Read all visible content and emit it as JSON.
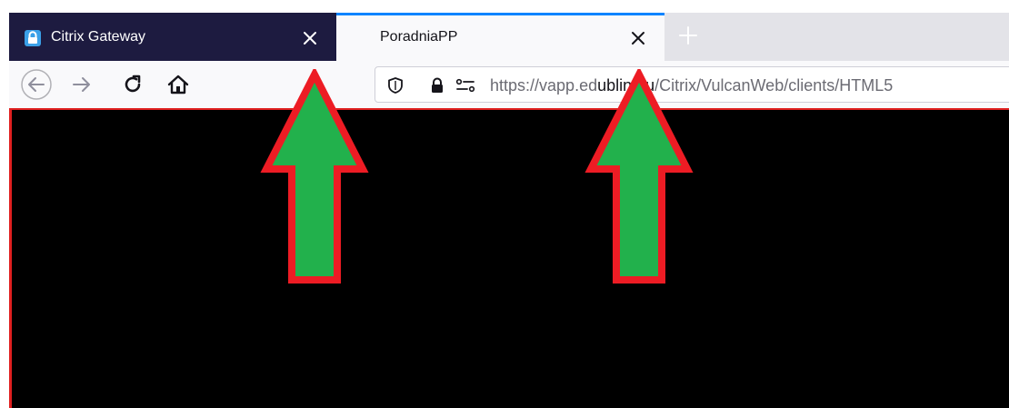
{
  "tabs": [
    {
      "title": "Citrix Gateway",
      "active": false
    },
    {
      "title": "PoradniaPP",
      "active": true
    }
  ],
  "toolbar": {
    "url_prefix": "https://",
    "url_host_pre": "vapp.ed",
    "url_host_post": "ublin.eu",
    "url_path": "/Citrix/VulcanWeb/clients/HTML5"
  },
  "colors": {
    "inactive_tab_bg": "#1d1b40",
    "active_tab_accent": "#0a84ff",
    "annotation_fill": "#22b14c",
    "annotation_stroke": "#ed1c24"
  }
}
